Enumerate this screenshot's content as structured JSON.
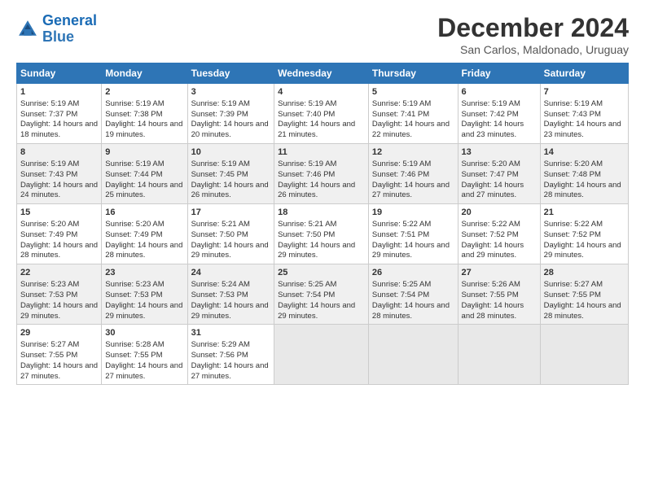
{
  "logo": {
    "line1": "General",
    "line2": "Blue"
  },
  "title": "December 2024",
  "subtitle": "San Carlos, Maldonado, Uruguay",
  "headers": [
    "Sunday",
    "Monday",
    "Tuesday",
    "Wednesday",
    "Thursday",
    "Friday",
    "Saturday"
  ],
  "weeks": [
    [
      {
        "day": "1",
        "rise": "Sunrise: 5:19 AM",
        "set": "Sunset: 7:37 PM",
        "daylight": "Daylight: 14 hours and 18 minutes."
      },
      {
        "day": "2",
        "rise": "Sunrise: 5:19 AM",
        "set": "Sunset: 7:38 PM",
        "daylight": "Daylight: 14 hours and 19 minutes."
      },
      {
        "day": "3",
        "rise": "Sunrise: 5:19 AM",
        "set": "Sunset: 7:39 PM",
        "daylight": "Daylight: 14 hours and 20 minutes."
      },
      {
        "day": "4",
        "rise": "Sunrise: 5:19 AM",
        "set": "Sunset: 7:40 PM",
        "daylight": "Daylight: 14 hours and 21 minutes."
      },
      {
        "day": "5",
        "rise": "Sunrise: 5:19 AM",
        "set": "Sunset: 7:41 PM",
        "daylight": "Daylight: 14 hours and 22 minutes."
      },
      {
        "day": "6",
        "rise": "Sunrise: 5:19 AM",
        "set": "Sunset: 7:42 PM",
        "daylight": "Daylight: 14 hours and 23 minutes."
      },
      {
        "day": "7",
        "rise": "Sunrise: 5:19 AM",
        "set": "Sunset: 7:43 PM",
        "daylight": "Daylight: 14 hours and 23 minutes."
      }
    ],
    [
      {
        "day": "8",
        "rise": "Sunrise: 5:19 AM",
        "set": "Sunset: 7:43 PM",
        "daylight": "Daylight: 14 hours and 24 minutes."
      },
      {
        "day": "9",
        "rise": "Sunrise: 5:19 AM",
        "set": "Sunset: 7:44 PM",
        "daylight": "Daylight: 14 hours and 25 minutes."
      },
      {
        "day": "10",
        "rise": "Sunrise: 5:19 AM",
        "set": "Sunset: 7:45 PM",
        "daylight": "Daylight: 14 hours and 26 minutes."
      },
      {
        "day": "11",
        "rise": "Sunrise: 5:19 AM",
        "set": "Sunset: 7:46 PM",
        "daylight": "Daylight: 14 hours and 26 minutes."
      },
      {
        "day": "12",
        "rise": "Sunrise: 5:19 AM",
        "set": "Sunset: 7:46 PM",
        "daylight": "Daylight: 14 hours and 27 minutes."
      },
      {
        "day": "13",
        "rise": "Sunrise: 5:20 AM",
        "set": "Sunset: 7:47 PM",
        "daylight": "Daylight: 14 hours and 27 minutes."
      },
      {
        "day": "14",
        "rise": "Sunrise: 5:20 AM",
        "set": "Sunset: 7:48 PM",
        "daylight": "Daylight: 14 hours and 28 minutes."
      }
    ],
    [
      {
        "day": "15",
        "rise": "Sunrise: 5:20 AM",
        "set": "Sunset: 7:49 PM",
        "daylight": "Daylight: 14 hours and 28 minutes."
      },
      {
        "day": "16",
        "rise": "Sunrise: 5:20 AM",
        "set": "Sunset: 7:49 PM",
        "daylight": "Daylight: 14 hours and 28 minutes."
      },
      {
        "day": "17",
        "rise": "Sunrise: 5:21 AM",
        "set": "Sunset: 7:50 PM",
        "daylight": "Daylight: 14 hours and 29 minutes."
      },
      {
        "day": "18",
        "rise": "Sunrise: 5:21 AM",
        "set": "Sunset: 7:50 PM",
        "daylight": "Daylight: 14 hours and 29 minutes."
      },
      {
        "day": "19",
        "rise": "Sunrise: 5:22 AM",
        "set": "Sunset: 7:51 PM",
        "daylight": "Daylight: 14 hours and 29 minutes."
      },
      {
        "day": "20",
        "rise": "Sunrise: 5:22 AM",
        "set": "Sunset: 7:52 PM",
        "daylight": "Daylight: 14 hours and 29 minutes."
      },
      {
        "day": "21",
        "rise": "Sunrise: 5:22 AM",
        "set": "Sunset: 7:52 PM",
        "daylight": "Daylight: 14 hours and 29 minutes."
      }
    ],
    [
      {
        "day": "22",
        "rise": "Sunrise: 5:23 AM",
        "set": "Sunset: 7:53 PM",
        "daylight": "Daylight: 14 hours and 29 minutes."
      },
      {
        "day": "23",
        "rise": "Sunrise: 5:23 AM",
        "set": "Sunset: 7:53 PM",
        "daylight": "Daylight: 14 hours and 29 minutes."
      },
      {
        "day": "24",
        "rise": "Sunrise: 5:24 AM",
        "set": "Sunset: 7:53 PM",
        "daylight": "Daylight: 14 hours and 29 minutes."
      },
      {
        "day": "25",
        "rise": "Sunrise: 5:25 AM",
        "set": "Sunset: 7:54 PM",
        "daylight": "Daylight: 14 hours and 29 minutes."
      },
      {
        "day": "26",
        "rise": "Sunrise: 5:25 AM",
        "set": "Sunset: 7:54 PM",
        "daylight": "Daylight: 14 hours and 28 minutes."
      },
      {
        "day": "27",
        "rise": "Sunrise: 5:26 AM",
        "set": "Sunset: 7:55 PM",
        "daylight": "Daylight: 14 hours and 28 minutes."
      },
      {
        "day": "28",
        "rise": "Sunrise: 5:27 AM",
        "set": "Sunset: 7:55 PM",
        "daylight": "Daylight: 14 hours and 28 minutes."
      }
    ],
    [
      {
        "day": "29",
        "rise": "Sunrise: 5:27 AM",
        "set": "Sunset: 7:55 PM",
        "daylight": "Daylight: 14 hours and 27 minutes."
      },
      {
        "day": "30",
        "rise": "Sunrise: 5:28 AM",
        "set": "Sunset: 7:55 PM",
        "daylight": "Daylight: 14 hours and 27 minutes."
      },
      {
        "day": "31",
        "rise": "Sunrise: 5:29 AM",
        "set": "Sunset: 7:56 PM",
        "daylight": "Daylight: 14 hours and 27 minutes."
      },
      null,
      null,
      null,
      null
    ]
  ]
}
